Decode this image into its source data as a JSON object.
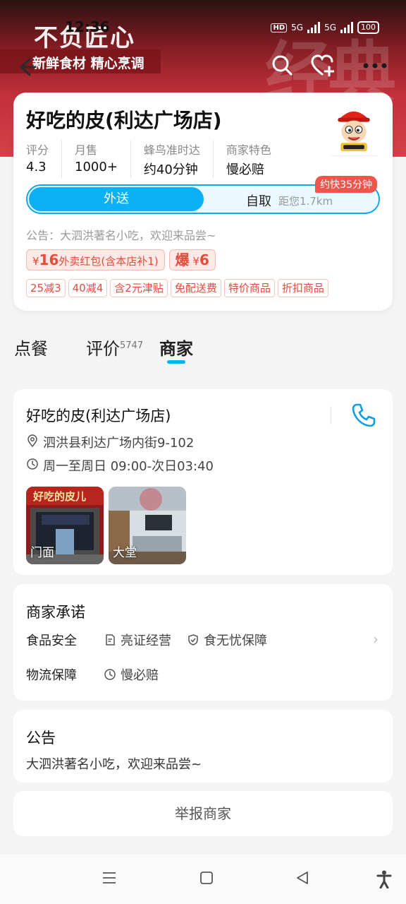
{
  "status_bar": {
    "time": "12:36",
    "battery": "100",
    "hd_label": "HD",
    "net1": "5G",
    "net2": "5G"
  },
  "banner": {
    "slogan_large": "不负匠心",
    "slogan_small": "新鲜食材 精心烹调",
    "watermark": "经典"
  },
  "shop": {
    "name": "好吃的皮(利达广场店)",
    "stats": [
      {
        "label": "评分",
        "value": "4.3"
      },
      {
        "label": "月售",
        "value": "1000+"
      },
      {
        "label": "蜂鸟准时达",
        "value": "约40分钟"
      },
      {
        "label": "商家特色",
        "value": "慢必赔"
      }
    ],
    "mode": {
      "delivery": "外送",
      "pickup": "自取",
      "distance": "距您1.7km",
      "fast_tag": "约快35分钟"
    },
    "notice": "公告：大泗洪著名小吃，欢迎来品尝~",
    "red_packets": [
      {
        "amount": "16",
        "currency": "¥",
        "text": "外卖红包(含本店补1)"
      },
      {
        "prefix": "爆",
        "currency": "¥",
        "amount": "6"
      }
    ],
    "promotions": [
      "25减3",
      "40减4",
      "含2元津贴",
      "免配送费",
      "特价商品",
      "折扣商品"
    ]
  },
  "tabs": [
    {
      "label": "点餐"
    },
    {
      "label": "评价",
      "count": "5747"
    },
    {
      "label": "商家",
      "active": true
    }
  ],
  "merchant_info": {
    "name": "好吃的皮(利达广场店)",
    "address": "泗洪县利达广场内街9-102",
    "hours": "周一至周日 09:00-次日03:40",
    "photos": [
      {
        "caption": "门面"
      },
      {
        "caption": "大堂"
      }
    ],
    "storefront_sign": "好吃的皮儿"
  },
  "promise": {
    "title": "商家承诺",
    "food_safety_label": "食品安全",
    "food_safety_items": [
      "亮证经营",
      "食无忧保障"
    ],
    "logistics_label": "物流保障",
    "logistics_items": [
      "慢必赔"
    ]
  },
  "announcement": {
    "title": "公告",
    "text": "大泗洪著名小吃，欢迎来品尝~"
  },
  "report_button": "举报商家",
  "colors": {
    "accent": "#0bb0f5",
    "promo_red": "#e84a3c",
    "banner_red": "#c2303b"
  }
}
